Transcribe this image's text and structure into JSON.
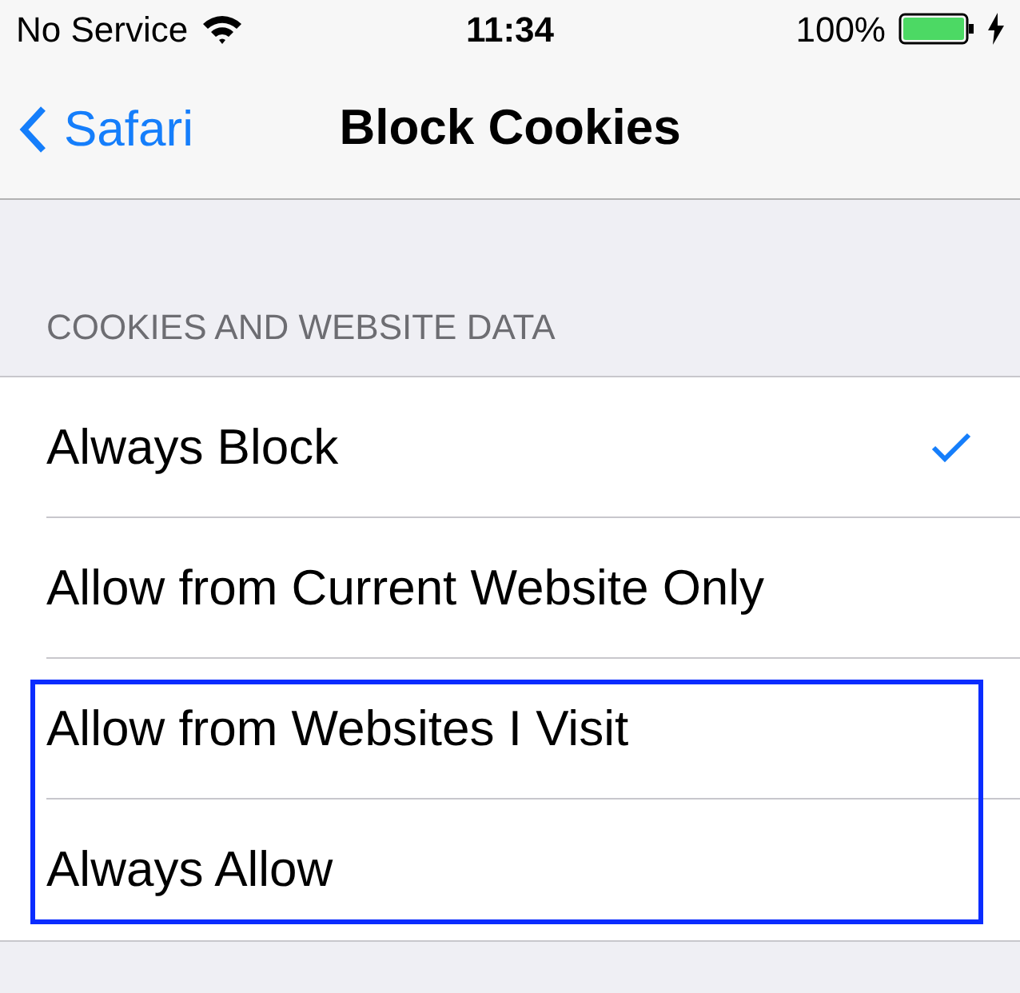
{
  "status_bar": {
    "carrier": "No Service",
    "time": "11:34",
    "battery": "100%",
    "charging": true
  },
  "nav_bar": {
    "back": "Safari",
    "title": "Block Cookies"
  },
  "section": {
    "header": "COOKIES AND WEBSITE DATA",
    "options": [
      {
        "label": "Always Block",
        "selected": true,
        "highlighted": false
      },
      {
        "label": "Allow from Current Website Only",
        "selected": false,
        "highlighted": false
      },
      {
        "label": "Allow from Websites I Visit",
        "selected": false,
        "highlighted": true
      },
      {
        "label": "Always Allow",
        "selected": false,
        "highlighted": true
      }
    ]
  }
}
